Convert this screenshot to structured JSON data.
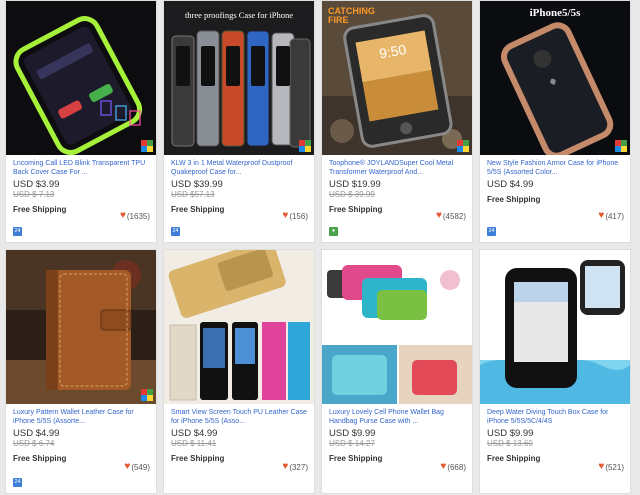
{
  "products": [
    {
      "title": "Lncoming Call LED Blink Transparent TPU Back Cover Case For ...",
      "price": "USD $3.99",
      "original_price": "USD $ 7.13",
      "shipping": "Free Shipping",
      "likes": "(1635)",
      "store_icon": "24-hour-icon",
      "image_caption": ""
    },
    {
      "title": "KLW 3 in 1 Metal Waterproof Dustproof Quakeproof Case for...",
      "price": "USD $39.99",
      "original_price": "USD $57.13",
      "shipping": "Free Shipping",
      "likes": "(156)",
      "store_icon": "24-hour-icon",
      "image_caption": "three proofings Case for iPhone"
    },
    {
      "title": "Toophone® JOYLANDSuper Cool Metal Transformer Waterproof And...",
      "price": "USD $19.99",
      "original_price": "USD $ 39.99",
      "shipping": "Free Shipping",
      "likes": "(4582)",
      "store_icon": "location-pin-icon",
      "image_caption": "CATCHING FIRE"
    },
    {
      "title": "New Style Fashion Armor Case for iPhone 5/5S (Assorted Color...",
      "price": "USD $4.99",
      "original_price": "",
      "shipping": "Free Shipping",
      "likes": "(417)",
      "store_icon": "24-hour-icon",
      "image_caption": "iPhone5/5s"
    },
    {
      "title": "Luxury Pattern Wallet Leather Case for iPhone 5/5S (Assorte...",
      "price": "USD $4.99",
      "original_price": "USD $ 6.74",
      "shipping": "Free Shipping",
      "likes": "(549)",
      "store_icon": "24-hour-icon",
      "image_caption": ""
    },
    {
      "title": "Smart View Screen Touch PU Leather Case for iPhone 5/5S (Asso...",
      "price": "USD $4.99",
      "original_price": "USD $ 11.41",
      "shipping": "Free Shipping",
      "likes": "(327)",
      "store_icon": "",
      "image_caption": ""
    },
    {
      "title": "Luxury Lovely Cell Phone Wallet Bag Handbag Purse Case with ...",
      "price": "USD $9.99",
      "original_price": "USD $ 14.27",
      "shipping": "Free Shipping",
      "likes": "(668)",
      "store_icon": "",
      "image_caption": ""
    },
    {
      "title": "Deep Water Diving Touch Box Case for iPhone 5/5S/5C/4/4S",
      "price": "USD $9.99",
      "original_price": "USD $ 13.60",
      "shipping": "Free Shipping",
      "likes": "(521)",
      "store_icon": "",
      "image_caption": ""
    }
  ],
  "icons": {
    "like": "heart-icon",
    "corner_badge": "multicolor-badge-icon"
  },
  "colors": {
    "title_link": "#3366cc",
    "heart": "#e4572e",
    "store_badge": "#3c7ed8",
    "pin_badge": "#4aa34a"
  },
  "store_icon_labels": {
    "24": "24",
    "pin": "●"
  }
}
